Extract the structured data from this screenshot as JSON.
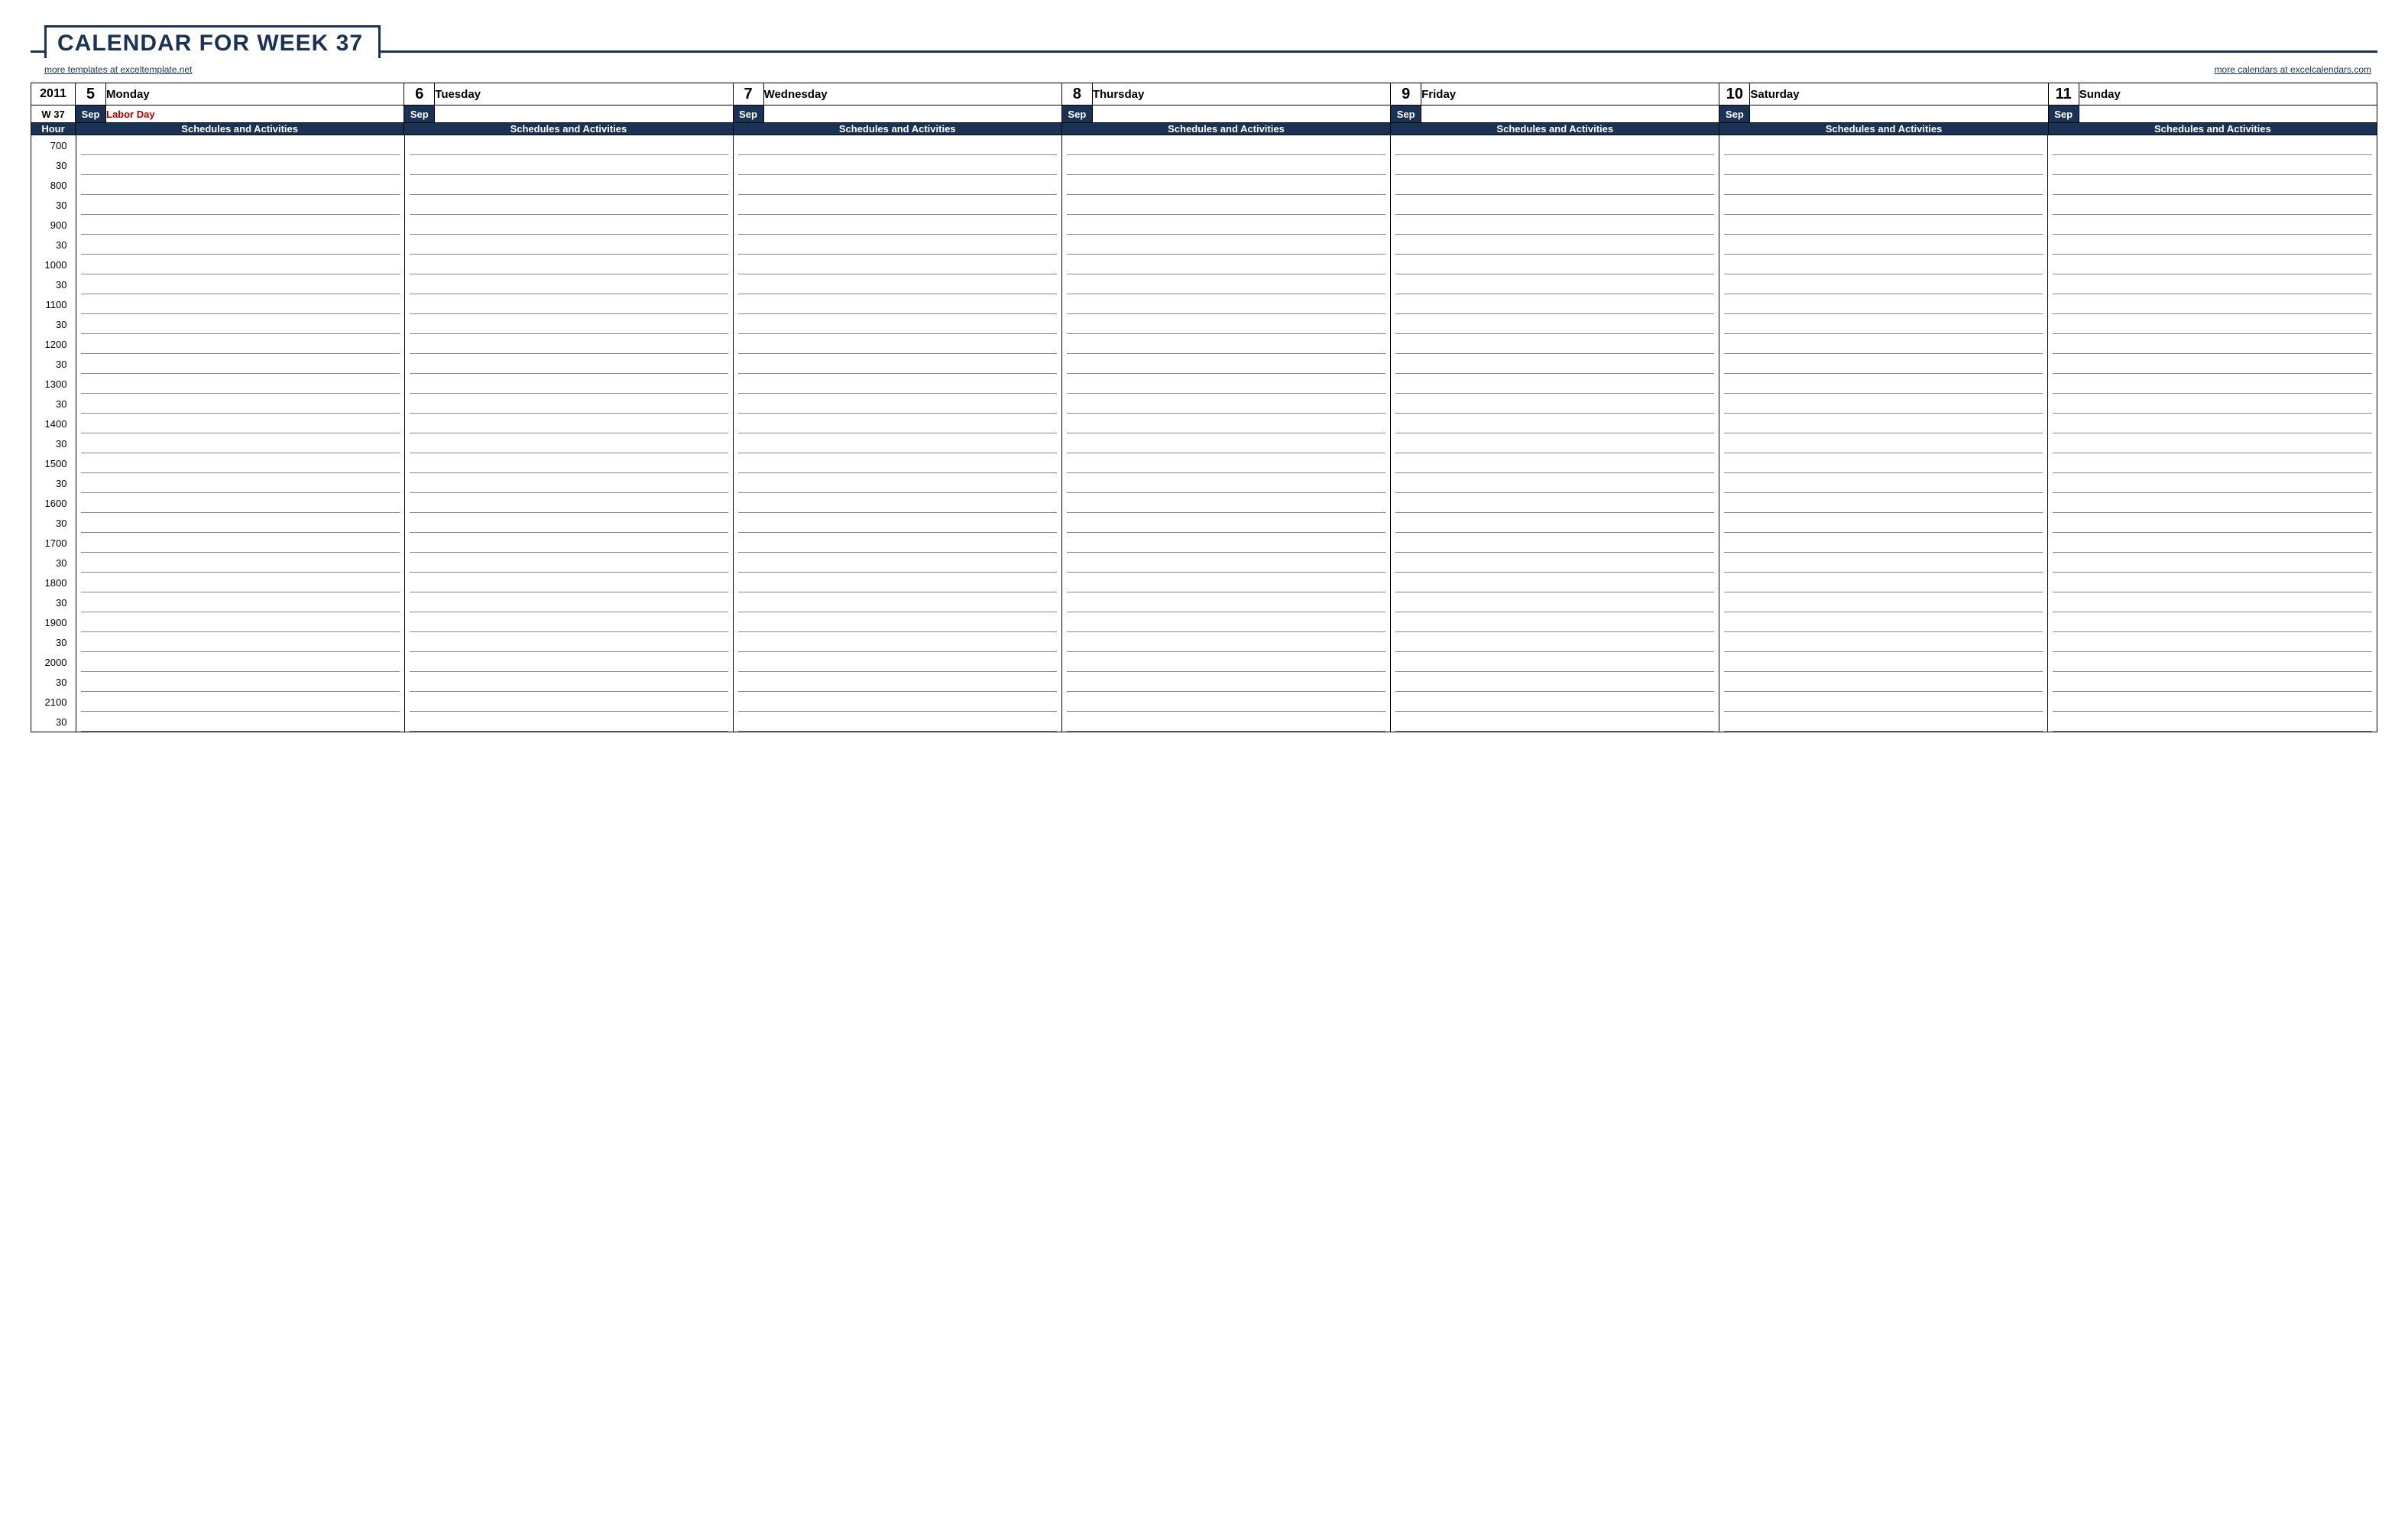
{
  "title": "Calendar for Week 37",
  "links": {
    "left": "more templates at exceltemplate.net",
    "right": "more calendars at excelcalendars.com"
  },
  "year": "2011",
  "week_label": "W 37",
  "hour_header": "Hour",
  "schedule_header": "Schedules and Activities",
  "days": [
    {
      "date": "5",
      "name": "Monday",
      "month": "Sep",
      "holiday": "Labor Day"
    },
    {
      "date": "6",
      "name": "Tuesday",
      "month": "Sep",
      "holiday": ""
    },
    {
      "date": "7",
      "name": "Wednesday",
      "month": "Sep",
      "holiday": ""
    },
    {
      "date": "8",
      "name": "Thursday",
      "month": "Sep",
      "holiday": ""
    },
    {
      "date": "9",
      "name": "Friday",
      "month": "Sep",
      "holiday": ""
    },
    {
      "date": "10",
      "name": "Saturday",
      "month": "Sep",
      "holiday": ""
    },
    {
      "date": "11",
      "name": "Sunday",
      "month": "Sep",
      "holiday": ""
    }
  ],
  "hours": [
    {
      "h": "7",
      "m": "00"
    },
    {
      "h": "",
      "m": "30"
    },
    {
      "h": "8",
      "m": "00"
    },
    {
      "h": "",
      "m": "30"
    },
    {
      "h": "9",
      "m": "00"
    },
    {
      "h": "",
      "m": "30"
    },
    {
      "h": "10",
      "m": "00"
    },
    {
      "h": "",
      "m": "30"
    },
    {
      "h": "11",
      "m": "00"
    },
    {
      "h": "",
      "m": "30"
    },
    {
      "h": "12",
      "m": "00"
    },
    {
      "h": "",
      "m": "30"
    },
    {
      "h": "13",
      "m": "00"
    },
    {
      "h": "",
      "m": "30"
    },
    {
      "h": "14",
      "m": "00"
    },
    {
      "h": "",
      "m": "30"
    },
    {
      "h": "15",
      "m": "00"
    },
    {
      "h": "",
      "m": "30"
    },
    {
      "h": "16",
      "m": "00"
    },
    {
      "h": "",
      "m": "30"
    },
    {
      "h": "17",
      "m": "00"
    },
    {
      "h": "",
      "m": "30"
    },
    {
      "h": "18",
      "m": "00"
    },
    {
      "h": "",
      "m": "30"
    },
    {
      "h": "19",
      "m": "00"
    },
    {
      "h": "",
      "m": "30"
    },
    {
      "h": "20",
      "m": "00"
    },
    {
      "h": "",
      "m": "30"
    },
    {
      "h": "21",
      "m": "00"
    },
    {
      "h": "",
      "m": "30"
    }
  ]
}
